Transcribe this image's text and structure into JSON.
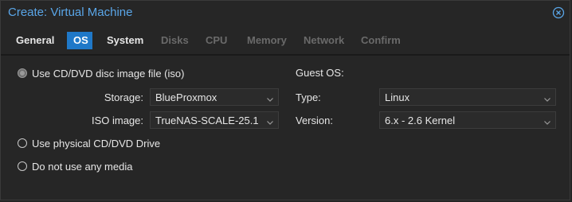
{
  "window": {
    "title": "Create: Virtual Machine"
  },
  "tabs": [
    {
      "label": "General",
      "state": "enabled"
    },
    {
      "label": "OS",
      "state": "active"
    },
    {
      "label": "System",
      "state": "enabled"
    },
    {
      "label": "Disks",
      "state": "disabled"
    },
    {
      "label": "CPU",
      "state": "disabled"
    },
    {
      "label": "Memory",
      "state": "disabled"
    },
    {
      "label": "Network",
      "state": "disabled"
    },
    {
      "label": "Confirm",
      "state": "disabled"
    }
  ],
  "media": {
    "iso_option": {
      "label": "Use CD/DVD disc image file (iso)",
      "checked": true
    },
    "storage": {
      "label": "Storage:",
      "value": "BlueProxmox"
    },
    "iso_image": {
      "label": "ISO image:",
      "value": "TrueNAS-SCALE-25.1"
    },
    "physical_option": {
      "label": "Use physical CD/DVD Drive",
      "checked": false
    },
    "no_media_option": {
      "label": "Do not use any media",
      "checked": false
    }
  },
  "guest_os": {
    "heading": "Guest OS:",
    "type": {
      "label": "Type:",
      "value": "Linux"
    },
    "version": {
      "label": "Version:",
      "value": "6.x - 2.6 Kernel"
    }
  },
  "colors": {
    "accent": "#1f78c8",
    "title": "#5aa6e8",
    "background": "#262626"
  },
  "icons": {
    "close": "close-circle-icon",
    "dropdown": "chevron-down-icon"
  }
}
